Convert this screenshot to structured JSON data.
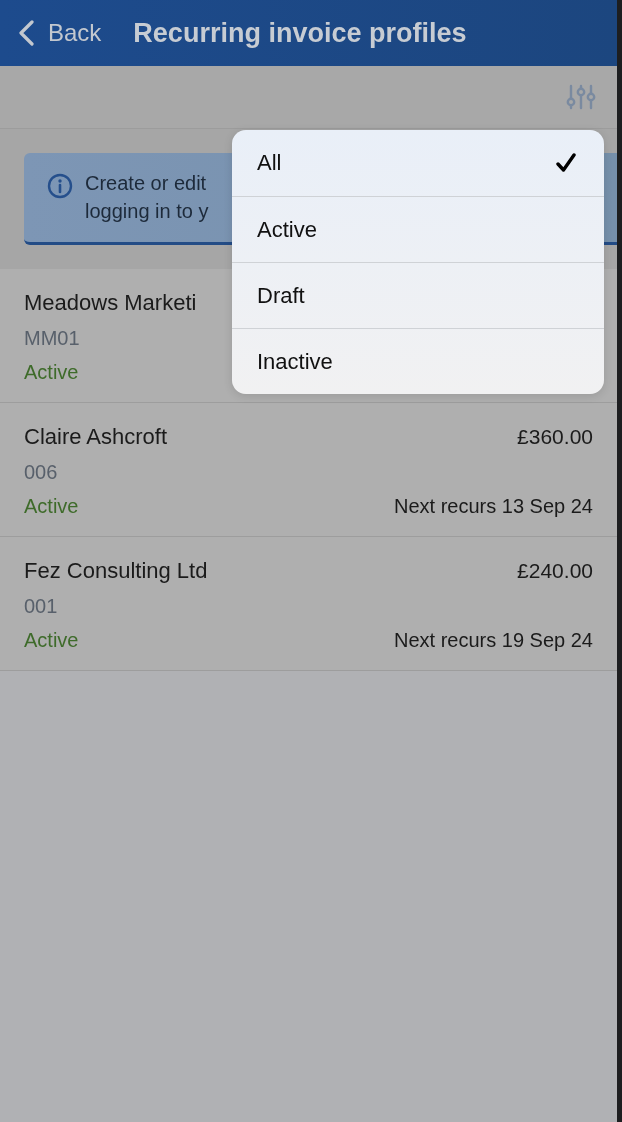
{
  "header": {
    "back_label": "Back",
    "title": "Recurring invoice profiles"
  },
  "info_banner": {
    "lines": [
      "Create or edit",
      "logging in to y"
    ]
  },
  "profiles": [
    {
      "name": "Meadows Marketi",
      "reference": "MM01",
      "status": "Active"
    },
    {
      "name": "Claire Ashcroft",
      "reference": "006",
      "status": "Active",
      "amount": "£360.00",
      "next_recurrence": "Next recurs 13 Sep 24"
    },
    {
      "name": "Fez Consulting Ltd",
      "reference": "001",
      "status": "Active",
      "amount": "£240.00",
      "next_recurrence": "Next recurs 19 Sep 24"
    }
  ],
  "filter_menu": {
    "options": [
      {
        "label": "All",
        "selected": true
      },
      {
        "label": "Active",
        "selected": false
      },
      {
        "label": "Draft",
        "selected": false
      },
      {
        "label": "Inactive",
        "selected": false
      }
    ]
  }
}
